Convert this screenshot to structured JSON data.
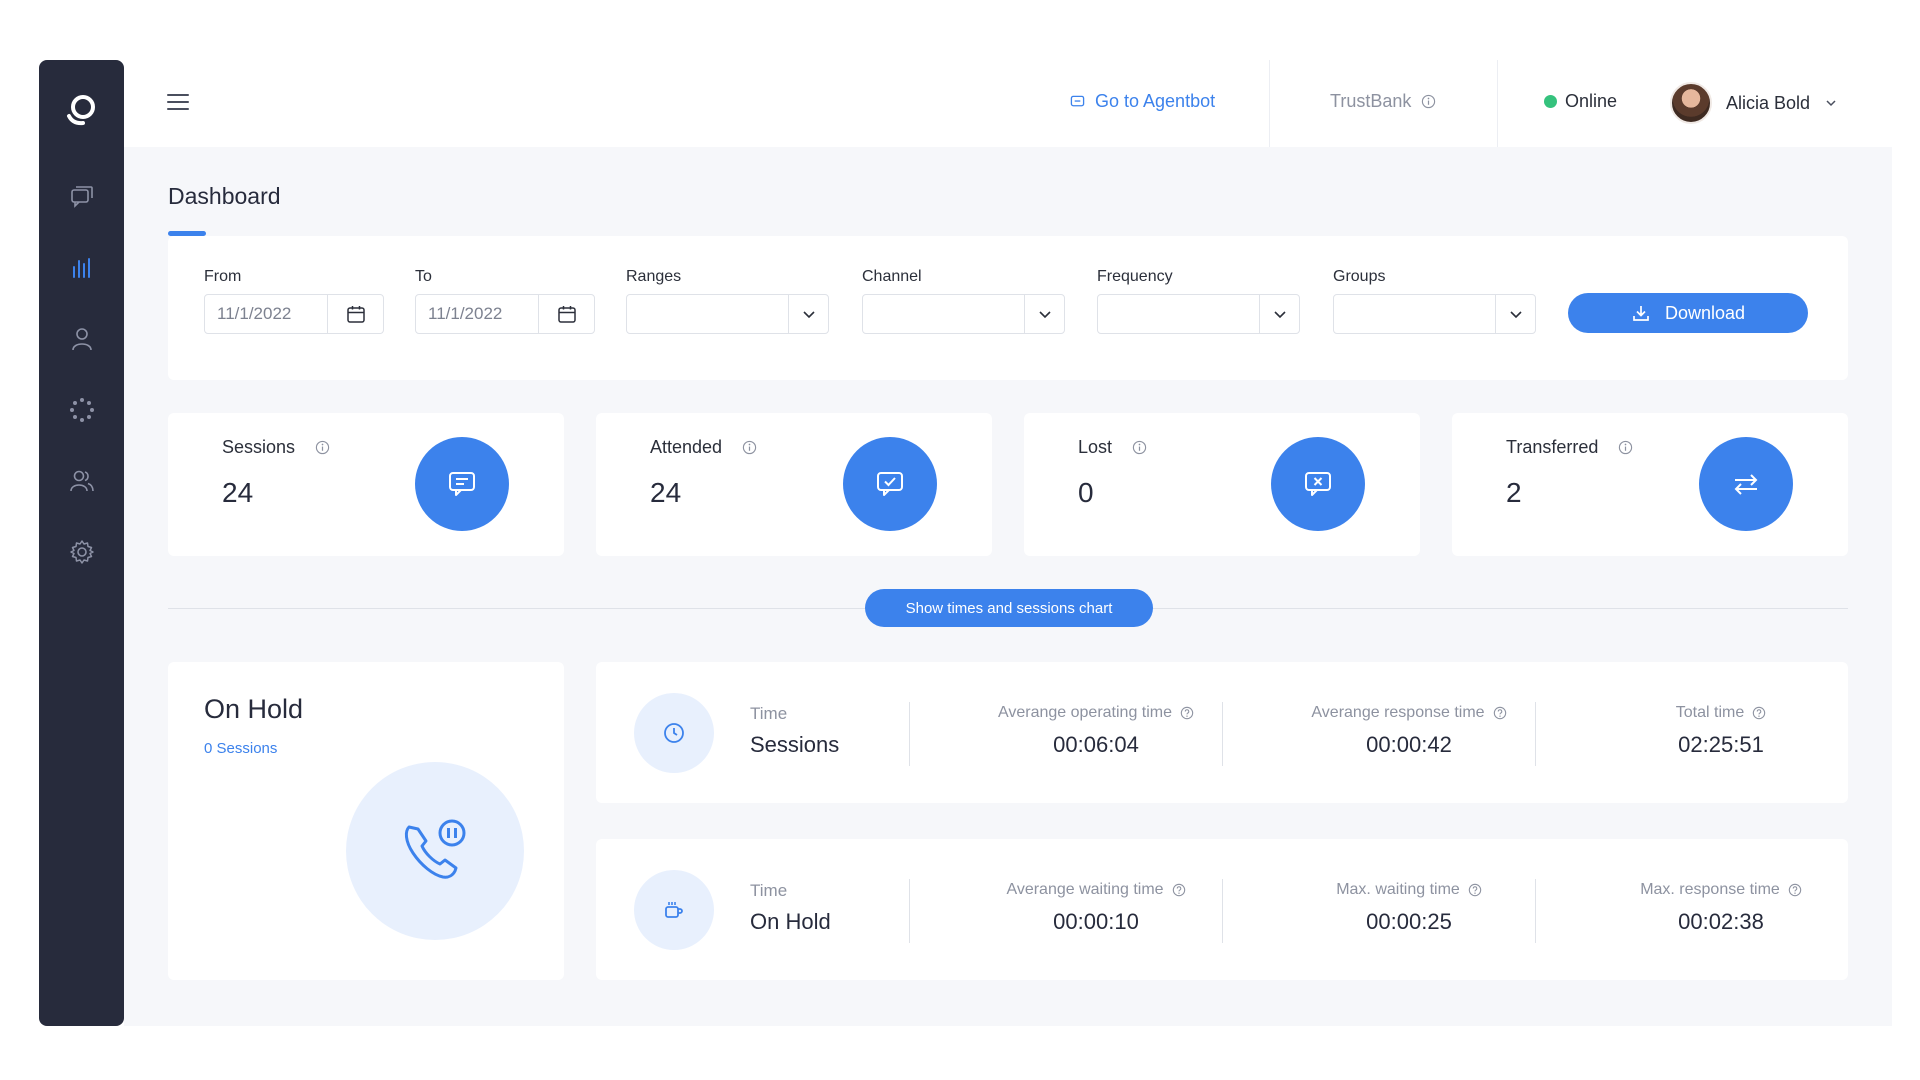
{
  "header": {
    "agentbot_label": "Go to Agentbot",
    "company": "TrustBank",
    "status": "Online",
    "user_name": "Alicia Bold"
  },
  "page": {
    "title": "Dashboard"
  },
  "filters": {
    "from_label": "From",
    "from_value": "11/1/2022",
    "to_label": "To",
    "to_value": "11/1/2022",
    "ranges_label": "Ranges",
    "channel_label": "Channel",
    "frequency_label": "Frequency",
    "groups_label": "Groups",
    "download_label": "Download"
  },
  "stats": [
    {
      "label": "Sessions",
      "value": "24",
      "icon": "chat-icon"
    },
    {
      "label": "Attended",
      "value": "24",
      "icon": "chat-check-icon"
    },
    {
      "label": "Lost",
      "value": "0",
      "icon": "chat-x-icon"
    },
    {
      "label": "Transferred",
      "value": "2",
      "icon": "transfer-arrows-icon"
    }
  ],
  "chart_toggle_label": "Show times and sessions chart",
  "on_hold": {
    "title": "On Hold",
    "sessions_link": "0 Sessions"
  },
  "sessions_times": {
    "title_small": "Time",
    "title_big": "Sessions",
    "metrics": [
      {
        "label": "Averange operating time",
        "value": "00:06:04"
      },
      {
        "label": "Averange response time",
        "value": "00:00:42"
      },
      {
        "label": "Total time",
        "value": "02:25:51"
      }
    ]
  },
  "hold_times": {
    "title_small": "Time",
    "title_big": "On Hold",
    "metrics": [
      {
        "label": "Averange waiting time",
        "value": "00:00:10"
      },
      {
        "label": "Max. waiting time",
        "value": "00:00:25"
      },
      {
        "label": "Max. response time",
        "value": "00:02:38"
      }
    ]
  },
  "colors": {
    "sidebar": "#272b3c",
    "accent": "#3c82ec",
    "online": "#35c27d",
    "background": "#f6f7fa"
  }
}
